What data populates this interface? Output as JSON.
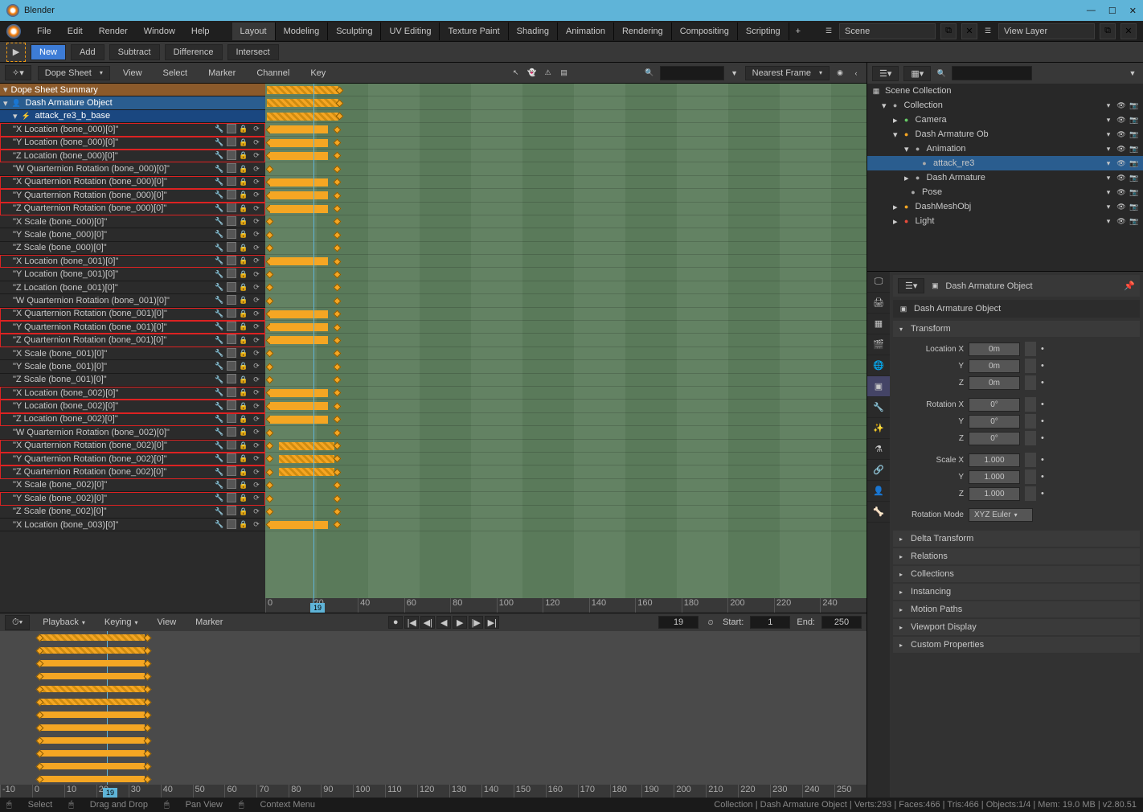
{
  "window": {
    "title": "Blender"
  },
  "topmenu": {
    "items": [
      "File",
      "Edit",
      "Render",
      "Window",
      "Help"
    ]
  },
  "workspaces": {
    "tabs": [
      "Layout",
      "Modeling",
      "Sculpting",
      "UV Editing",
      "Texture Paint",
      "Shading",
      "Animation",
      "Rendering",
      "Compositing",
      "Scripting"
    ],
    "active": 0
  },
  "scene": {
    "label": "Scene",
    "viewlayer": "View Layer"
  },
  "tool_header": {
    "new": "New",
    "add": "Add",
    "subtract": "Subtract",
    "difference": "Difference",
    "intersect": "Intersect"
  },
  "dope": {
    "mode": "Dope Sheet",
    "menus": [
      "View",
      "Select",
      "Marker",
      "Channel",
      "Key"
    ],
    "filter": "Nearest Frame",
    "summary": "Dope Sheet Summary",
    "object": "Dash Armature Object",
    "action": "attack_re3_b_base",
    "channels": [
      {
        "label": "\"X Location (bone_000)[0]\"",
        "red": true
      },
      {
        "label": "\"Y Location (bone_000)[0]\"",
        "red": true
      },
      {
        "label": "\"Z Location (bone_000)[0]\"",
        "red": true
      },
      {
        "label": "\"W Quarternion Rotation (bone_000)[0]\"",
        "red": false
      },
      {
        "label": "\"X Quarternion Rotation (bone_000)[0]\"",
        "red": true
      },
      {
        "label": "\"Y Quarternion Rotation (bone_000)[0]\"",
        "red": true
      },
      {
        "label": "\"Z Quarternion Rotation (bone_000)[0]\"",
        "red": true
      },
      {
        "label": "\"X Scale (bone_000)[0]\"",
        "red": false
      },
      {
        "label": "\"Y Scale (bone_000)[0]\"",
        "red": false
      },
      {
        "label": "\"Z Scale (bone_000)[0]\"",
        "red": false
      },
      {
        "label": "\"X Location (bone_001)[0]\"",
        "red": true
      },
      {
        "label": "\"Y Location (bone_001)[0]\"",
        "red": false
      },
      {
        "label": "\"Z Location (bone_001)[0]\"",
        "red": false
      },
      {
        "label": "\"W Quarternion Rotation (bone_001)[0]\"",
        "red": false
      },
      {
        "label": "\"X Quarternion Rotation (bone_001)[0]\"",
        "red": true
      },
      {
        "label": "\"Y Quarternion Rotation (bone_001)[0]\"",
        "red": true
      },
      {
        "label": "\"Z Quarternion Rotation (bone_001)[0]\"",
        "red": true
      },
      {
        "label": "\"X Scale (bone_001)[0]\"",
        "red": false
      },
      {
        "label": "\"Y Scale (bone_001)[0]\"",
        "red": false
      },
      {
        "label": "\"Z Scale (bone_001)[0]\"",
        "red": false
      },
      {
        "label": "\"X Location (bone_002)[0]\"",
        "red": true
      },
      {
        "label": "\"Y Location (bone_002)[0]\"",
        "red": true
      },
      {
        "label": "\"Z Location (bone_002)[0]\"",
        "red": true
      },
      {
        "label": "\"W Quarternion Rotation (bone_002)[0]\"",
        "red": false
      },
      {
        "label": "\"X Quarternion Rotation (bone_002)[0]\"",
        "red": true
      },
      {
        "label": "\"Y Quarternion Rotation (bone_002)[0]\"",
        "red": true
      },
      {
        "label": "\"Z Quarternion Rotation (bone_002)[0]\"",
        "red": true
      },
      {
        "label": "\"X Scale (bone_002)[0]\"",
        "red": false
      },
      {
        "label": "\"Y Scale (bone_002)[0]\"",
        "red": true
      },
      {
        "label": "\"Z Scale (bone_002)[0]\"",
        "red": false
      },
      {
        "label": "\"X Location (bone_003)[0]\"",
        "red": false
      }
    ],
    "ruler": [
      "0",
      "20",
      "40",
      "60",
      "80",
      "100",
      "120",
      "140",
      "160",
      "180",
      "200",
      "220",
      "240"
    ],
    "current_frame": "19"
  },
  "timeline": {
    "menus": [
      "Playback",
      "Keying",
      "View",
      "Marker"
    ],
    "current": "19",
    "start_label": "Start:",
    "start": "1",
    "end_label": "End:",
    "end": "250",
    "ruler": [
      "-10",
      "0",
      "10",
      "20",
      "30",
      "40",
      "50",
      "60",
      "70",
      "80",
      "90",
      "100",
      "110",
      "120",
      "130",
      "140",
      "150",
      "160",
      "170",
      "180",
      "190",
      "200",
      "210",
      "220",
      "230",
      "240",
      "250"
    ],
    "current_frame": "19"
  },
  "outliner": {
    "root": "Scene Collection",
    "items": [
      {
        "label": "Collection",
        "indent": 1,
        "icon": "collection",
        "chev": "down"
      },
      {
        "label": "Camera",
        "indent": 2,
        "icon": "camera",
        "chev": "right",
        "cam": true
      },
      {
        "label": "Dash Armature Ob",
        "indent": 2,
        "icon": "armature",
        "chev": "down",
        "orange": true
      },
      {
        "label": "Animation",
        "indent": 3,
        "icon": "anim",
        "chev": "down"
      },
      {
        "label": "attack_re3",
        "indent": 4,
        "icon": "action",
        "selected": true
      },
      {
        "label": "Dash Armature",
        "indent": 3,
        "icon": "bone",
        "chev": "right"
      },
      {
        "label": "Pose",
        "indent": 3,
        "icon": "pose"
      },
      {
        "label": "DashMeshObj",
        "indent": 2,
        "icon": "mesh",
        "chev": "right",
        "orange": true
      },
      {
        "label": "Light",
        "indent": 2,
        "icon": "light",
        "chev": "right",
        "red": true
      }
    ]
  },
  "properties": {
    "breadcrumb1": "Dash Armature Object",
    "breadcrumb2": "Dash Armature Object",
    "transform": {
      "title": "Transform",
      "loc_x": {
        "label": "Location X",
        "val": "0m"
      },
      "loc_y": {
        "label": "Y",
        "val": "0m"
      },
      "loc_z": {
        "label": "Z",
        "val": "0m"
      },
      "rot_x": {
        "label": "Rotation X",
        "val": "0°"
      },
      "rot_y": {
        "label": "Y",
        "val": "0°"
      },
      "rot_z": {
        "label": "Z",
        "val": "0°"
      },
      "scale_x": {
        "label": "Scale X",
        "val": "1.000"
      },
      "scale_y": {
        "label": "Y",
        "val": "1.000"
      },
      "scale_z": {
        "label": "Z",
        "val": "1.000"
      },
      "rot_mode_label": "Rotation Mode",
      "rot_mode": "XYZ Euler"
    },
    "panels": [
      "Delta Transform",
      "Relations",
      "Collections",
      "Instancing",
      "Motion Paths",
      "Viewport Display",
      "Custom Properties"
    ]
  },
  "statusbar": {
    "select": "Select",
    "drag": "Drag and Drop",
    "pan": "Pan View",
    "ctx": "Context Menu",
    "right": "Collection | Dash Armature Object | Verts:293 | Faces:466 | Tris:466 | Objects:1/4 | Mem: 19.0 MB | v2.80.51"
  }
}
